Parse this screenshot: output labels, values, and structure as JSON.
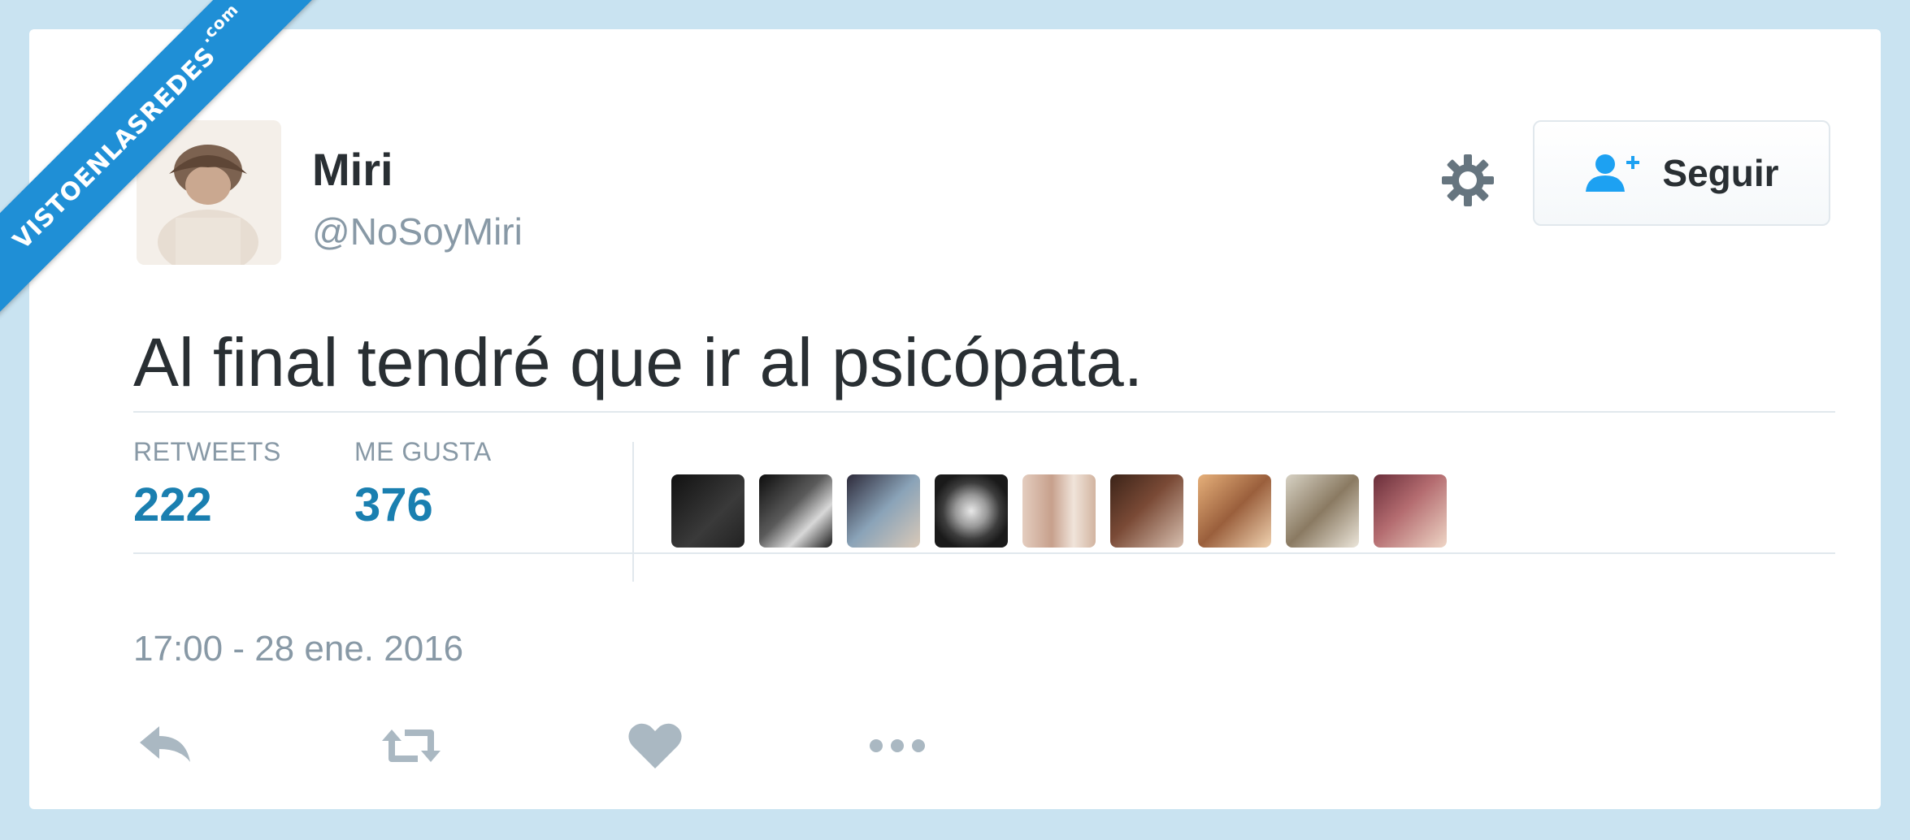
{
  "watermark": {
    "text": "VISTOENLASREDES",
    "suffix": ".com"
  },
  "tweet": {
    "author_name": "Miri",
    "author_handle": "@NoSoyMiri",
    "follow_label": "Seguir",
    "text": "Al final tendré que ir al psicópata.",
    "timestamp": "17:00 - 28 ene. 2016"
  },
  "stats": {
    "retweets_label": "RETWEETS",
    "retweets_value": "222",
    "likes_label": "ME GUSTA",
    "likes_value": "376"
  },
  "icons": {
    "settings": "gear-icon",
    "follow": "add-user-icon",
    "reply": "reply-icon",
    "retweet": "retweet-icon",
    "like": "heart-icon",
    "more": "more-icon"
  },
  "colors": {
    "page_background": "#c9e3f1",
    "stat_value": "#1a7fb0",
    "muted_text": "#8899a6",
    "icon_gray": "#aab8c2",
    "follow_icon": "#1da1f2",
    "watermark_blue": "#1f8fd6"
  }
}
